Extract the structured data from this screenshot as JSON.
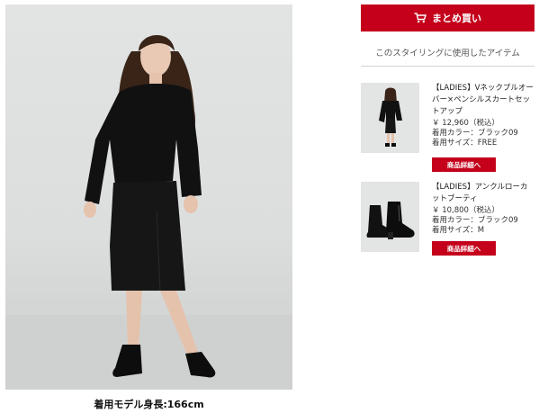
{
  "buttons": {
    "buy_all": "まとめ買い"
  },
  "styling": {
    "section_title": "このスタイリングに使用したアイテム",
    "model_height_caption": "着用モデル身長:166cm",
    "items": [
      {
        "name": "【LADIES】Vネックプルオーバー×ペンシルスカートセットアップ",
        "price": "￥ 12,960（税込）",
        "color": "着用カラー：ブラック09",
        "size": "着用サイズ：FREE",
        "detail_button": "商品詳細へ",
        "thumb_icon": "setup-outfit-thumbnail"
      },
      {
        "name": "【LADIES】アンクルローカットブーティ",
        "price": "￥ 10,800（税込）",
        "color": "着用カラー：ブラック09",
        "size": "着用サイズ：M",
        "detail_button": "商品詳細へ",
        "thumb_icon": "ankle-bootie-thumbnail"
      }
    ]
  },
  "icons": {
    "cart": "shopping-cart-icon"
  },
  "colors": {
    "accent": "#c4001b",
    "photo_background": "#dedfdf",
    "garment": "#111111"
  }
}
